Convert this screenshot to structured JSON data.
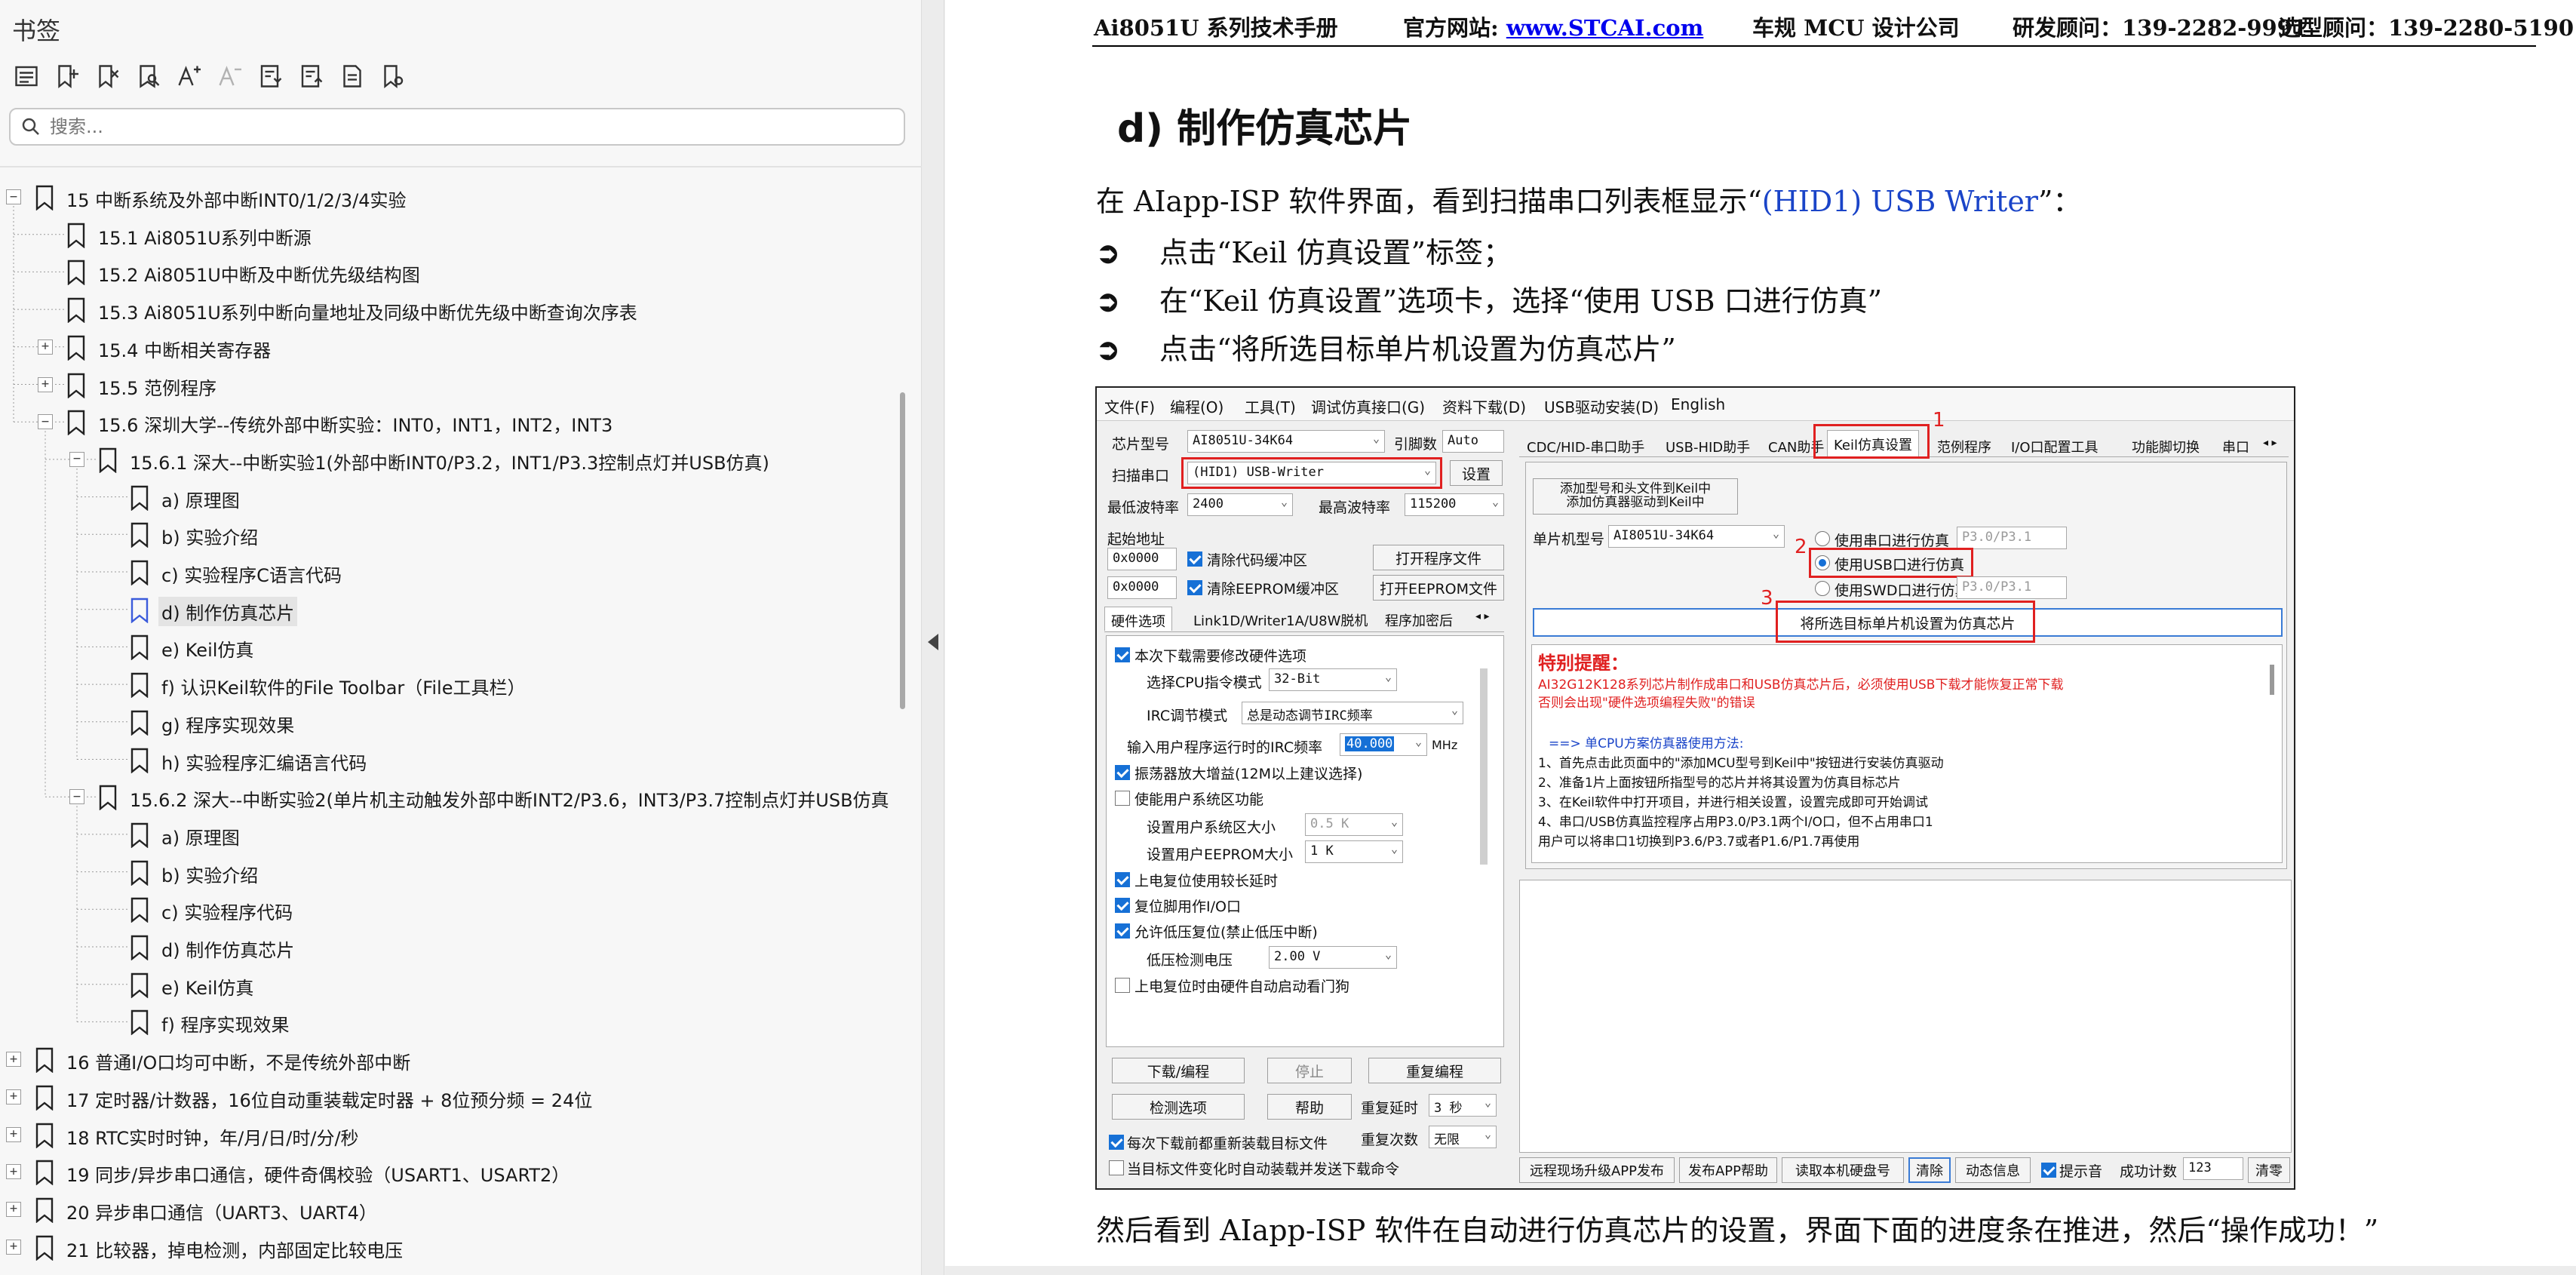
{
  "panel": {
    "title": "书签",
    "search_placeholder": "搜索...",
    "toolbar_icons": [
      "list-icon",
      "add-bookmark-icon",
      "delete-bookmark-icon",
      "find-bookmark-icon",
      "font-larger-icon",
      "font-smaller-icon",
      "expand-all-icon",
      "collapse-all-icon",
      "page-icon",
      "bookmark-settings-icon"
    ]
  },
  "tree": [
    {
      "level": 0,
      "toggle": "−",
      "label": "15  中断系统及外部中断INT0/1/2/3/4实验"
    },
    {
      "level": 1,
      "toggle": "",
      "label": "15.1 Ai8051U系列中断源"
    },
    {
      "level": 1,
      "toggle": "",
      "label": "15.2  Ai8051U中断及中断优先级结构图"
    },
    {
      "level": 1,
      "toggle": "",
      "label": "15.3  Ai8051U系列中断向量地址及同级中断优先级中断查询次序表"
    },
    {
      "level": 1,
      "toggle": "+",
      "label": "15.4  中断相关寄存器"
    },
    {
      "level": 1,
      "toggle": "+",
      "label": "15.5  范例程序"
    },
    {
      "level": 1,
      "toggle": "−",
      "label": "15.6  深圳大学--传统外部中断实验：INT0，INT1，INT2，INT3"
    },
    {
      "level": 2,
      "toggle": "−",
      "label": "15.6.1 深大--中断实验1(外部中断INT0/P3.2，INT1/P3.3控制点灯并USB仿真)"
    },
    {
      "level": 3,
      "toggle": "",
      "label": "a) 原理图"
    },
    {
      "level": 3,
      "toggle": "",
      "label": "b) 实验介绍"
    },
    {
      "level": 3,
      "toggle": "",
      "label": "c)  实验程序C语言代码"
    },
    {
      "level": 3,
      "toggle": "",
      "label": "d) 制作仿真芯片",
      "selected": true
    },
    {
      "level": 3,
      "toggle": "",
      "label": "e) Keil仿真"
    },
    {
      "level": 3,
      "toggle": "",
      "label": "f)  认识Keil软件的File Toolbar（File工具栏）"
    },
    {
      "level": 3,
      "toggle": "",
      "label": "g)  程序实现效果"
    },
    {
      "level": 3,
      "toggle": "",
      "label": "h)  实验程序汇编语言代码"
    },
    {
      "level": 2,
      "toggle": "−",
      "label": "15.6.2  深大--中断实验2(单片机主动触发外部中断INT2/P3.6，INT3/P3.7控制点灯并USB仿真)"
    },
    {
      "level": 3,
      "toggle": "",
      "label": "a) 原理图"
    },
    {
      "level": 3,
      "toggle": "",
      "label": "b) 实验介绍"
    },
    {
      "level": 3,
      "toggle": "",
      "label": "c)  实验程序代码"
    },
    {
      "level": 3,
      "toggle": "",
      "label": "d) 制作仿真芯片"
    },
    {
      "level": 3,
      "toggle": "",
      "label": "e) Keil仿真"
    },
    {
      "level": 3,
      "toggle": "",
      "label": "f) 程序实现效果"
    },
    {
      "level": 0,
      "toggle": "+",
      "label": "16  普通I/O口均可中断，不是传统外部中断"
    },
    {
      "level": 0,
      "toggle": "+",
      "label": "17  定时器/计数器，16位自动重装载定时器 + 8位预分频 = 24位"
    },
    {
      "level": 0,
      "toggle": "+",
      "label": "18  RTC实时时钟，年/月/日/时/分/秒"
    },
    {
      "level": 0,
      "toggle": "+",
      "label": "19  同步/异步串口通信，硬件奇偶校验（USART1、USART2）"
    },
    {
      "level": 0,
      "toggle": "+",
      "label": "20  异步串口通信（UART3、UART4）"
    },
    {
      "level": 0,
      "toggle": "+",
      "label": "21  比较器，掉电检测，内部固定比较电压"
    }
  ],
  "doc": {
    "header": {
      "manual": "Ai8051U 系列技术手册",
      "site_label": "官方网站: ",
      "site_url": "www.STCAI.com",
      "company": "车规 MCU 设计公司",
      "rd_contact": "研发顾问：139-2282-9991",
      "sel_contact": "选型顾问：139-2280-5190"
    },
    "heading": "d)  制作仿真芯片",
    "intro_pre": "在 AIapp-ISP 软件界面，看到扫描串口列表框显示“",
    "intro_hl": "(HID1) USB Writer",
    "intro_post": "”：",
    "bullets": [
      "点击“Keil 仿真设置”标签；",
      "在“Keil 仿真设置”选项卡，选择“使用 USB 口进行仿真”",
      "点击“将所选目标单片机设置为仿真芯片”"
    ],
    "bullet_mark": "➲",
    "bottom_text": "然后看到 AIapp-ISP 软件在自动进行仿真芯片的设置，界面下面的进度条在推进，然后“操作成功！”"
  },
  "shot": {
    "menu": [
      "文件(F)",
      "编程(O)",
      "工具(T)",
      "调试仿真接口(G)",
      "资料下载(D)",
      "USB驱动安装(D)",
      "English"
    ],
    "chip_label": "芯片型号",
    "chip_value": "AI8051U-34K64",
    "pins_label": "引脚数",
    "pins_value": "Auto",
    "scan_label": "扫描串口",
    "scan_value": "(HID1) USB-Writer",
    "settings_btn": "设置",
    "min_baud_label": "最低波特率",
    "min_baud": "2400",
    "max_baud_label": "最高波特率",
    "max_baud": "115200",
    "start_addr_label": "起始地址",
    "addr1": "0x0000",
    "addr2": "0x0000",
    "clear_code": "清除代码缓冲区",
    "clear_eeprom": "清除EEPROM缓冲区",
    "open_prog": "打开程序文件",
    "open_eeprom": "打开EEPROM文件",
    "left_tabs": [
      "硬件选项",
      "Link1D/Writer1A/U8W脱机",
      "程序加密后"
    ],
    "hw_options": {
      "opt1": "本次下载需要修改硬件选项",
      "cpu_mode_label": "选择CPU指令模式",
      "cpu_mode": "32-Bit",
      "irc_mode_label": "IRC调节模式",
      "irc_mode": "总是动态调节IRC频率",
      "freq_label": "输入用户程序运行时的IRC频率",
      "freq_value": "40.000",
      "freq_unit": "MHz",
      "osc": "振荡器放大增益(12M以上建议选择)",
      "user_sys_area": "使能用户系统区功能",
      "sys_area_size_label": "设置用户系统区大小",
      "sys_area_size": "0.5 K",
      "eeprom_size_label": "设置用户EEPROM大小",
      "eeprom_size": "1  K",
      "por_delay": "上电复位使用较长延时",
      "reset_io": "复位脚用作I/O口",
      "low_volt_reset": "允许低压复位(禁止低压中断)",
      "lvd_label": "低压检测电压",
      "lvd_value": "2.00 V",
      "watchdog": "上电复位时由硬件自动启动看门狗"
    },
    "btn_download": "下载/编程",
    "btn_stop": "停止",
    "btn_reprogram": "重复编程",
    "btn_check": "检测选项",
    "btn_help": "帮助",
    "repeat_delay_label": "重复延时",
    "repeat_delay": "3 秒",
    "repeat_count_label": "重复次数",
    "repeat_count": "无限",
    "reload_each": "每次下载前都重新装载目标文件",
    "auto_load": "当目标文件变化时自动装载并发送下载命令",
    "right_tabs": [
      "CDC/HID-串口助手",
      "USB-HID助手",
      "CAN助手",
      "Keil仿真设置",
      "范例程序",
      "I/O口配置工具",
      "功能脚切换",
      "串口"
    ],
    "add_model_btn_l1": "添加型号和头文件到Keil中",
    "add_model_btn_l2": "添加仿真器驱动到Keil中",
    "mcu_model_label": "单片机型号",
    "mcu_model": "AI8051U-34K64",
    "radio_serial": "使用串口进行仿真",
    "radio_serial_pin": "P3.0/P3.1",
    "radio_usb": "使用USB口进行仿真",
    "radio_swd": "使用SWD口进行仿真",
    "radio_swd_pin": "P3.0/P3.1",
    "set_emu_btn": "将所选目标单片机设置为仿真芯片",
    "warn_title": "特别提醒：",
    "warn_red_1": "AI32G12K128系列芯片制作成串口和USB仿真芯片后，必须使用USB下载才能恢复正常下载",
    "warn_red_2": "否则会出现\"硬件选项编程失败\"的错误",
    "warn_blue": "==> 单CPU方案仿真器使用方法:",
    "warn_steps": [
      "1、首先点击此页面中的\"添加MCU型号到Keil中\"按钮进行安装仿真驱动",
      "2、准备1片上面按钮所指型号的芯片并将其设置为仿真目标芯片",
      "3、在Keil软件中打开项目，并进行相关设置，设置完成即可开始调试",
      "4、串口/USB仿真监控程序占用P3.0/P3.1两个I/O口，但不占用串口1",
      "   用户可以将串口1切换到P3.6/P3.7或者P1.6/P1.7再使用"
    ],
    "num1": "1",
    "num2": "2",
    "num3": "3",
    "bottom_btns": [
      "远程现场升级APP发布",
      "发布APP帮助",
      "读取本机硬盘号",
      "清除",
      "动态信息"
    ],
    "beep_label": "提示音",
    "success_label": "成功计数",
    "success_count": "123",
    "clear_btn": "清零"
  }
}
